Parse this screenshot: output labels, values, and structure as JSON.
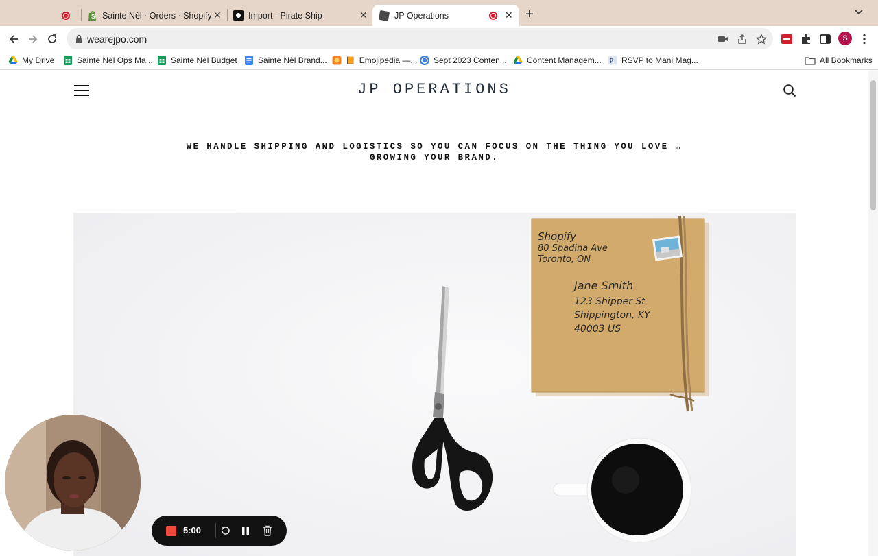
{
  "browser": {
    "tabs": [
      {
        "title": "",
        "favicon": "recording-dot-icon"
      },
      {
        "title": "Sainte Nèl · Orders · Shopify",
        "favicon": "shopify-icon"
      },
      {
        "title": "Import - Pirate Ship",
        "favicon": "pirate-ship-icon"
      },
      {
        "title": "JP Operations",
        "favicon": "jp-operations-icon",
        "active": true
      }
    ],
    "new_tab_label": "+",
    "url": "wearejpo.com",
    "profile_initial": "S",
    "bookmarks": [
      {
        "label": "My Drive",
        "icon": "google-drive-icon"
      },
      {
        "label": "Sainte Nèl Ops Ma...",
        "icon": "google-sheets-icon"
      },
      {
        "label": "Sainte Nèl Budget",
        "icon": "google-sheets-icon"
      },
      {
        "label": "Sainte Nèl Brand...",
        "icon": "google-docs-icon"
      },
      {
        "label": "Emojipedia —...",
        "icon": "emojipedia-icon"
      },
      {
        "label": "Sept 2023 Conten...",
        "icon": "canva-icon"
      },
      {
        "label": "Content Managem...",
        "icon": "google-drive-icon"
      },
      {
        "label": "RSVP to Mani Mag...",
        "icon": "paperless-post-icon"
      }
    ],
    "all_bookmarks_label": "All Bookmarks"
  },
  "site": {
    "brand": "JP OPERATIONS",
    "tagline": "WE HANDLE SHIPPING AND LOGISTICS SO YOU CAN FOCUS ON THE THING YOU LOVE … GROWING YOUR BRAND.",
    "package_label": {
      "from_name": "Shopify",
      "from_line1": "80 Spadina Ave",
      "from_line2": "Toronto, ON",
      "to_name": "Jane Smith",
      "to_line1": "123 Shipper St",
      "to_line2": "Shippington, KY",
      "to_line3": "40003 US"
    }
  },
  "recorder": {
    "time": "5:00"
  },
  "colors": {
    "tabstrip": "#e6d6c9",
    "recording_red": "#d21f2f",
    "brand_text": "#1f2a36",
    "kraft": "#d2ab6c"
  }
}
